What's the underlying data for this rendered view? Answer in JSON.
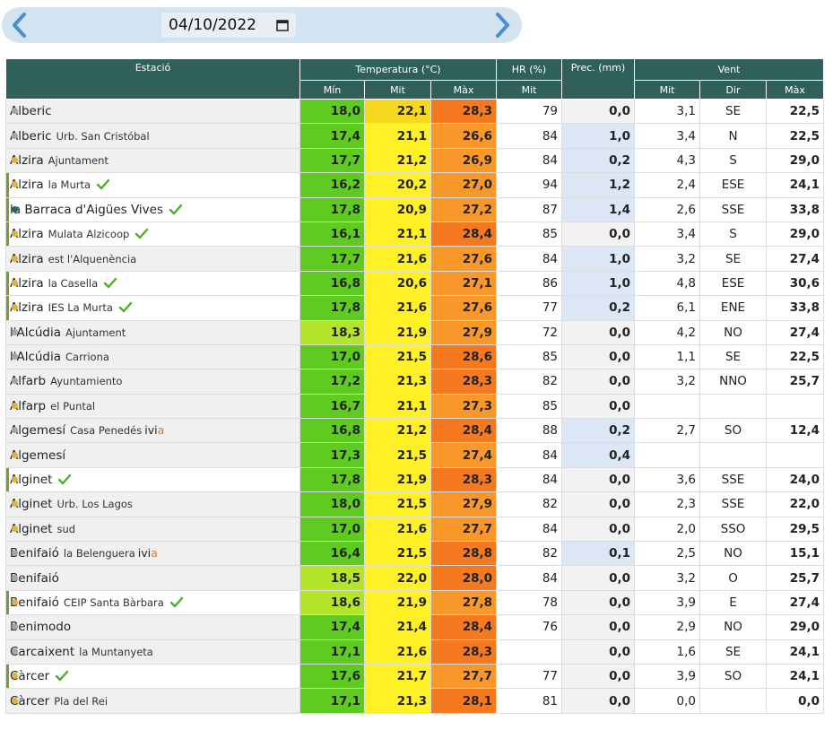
{
  "date": "04/10/2022",
  "headers": {
    "estacio": "Estació",
    "temperatura": "Temperatura (°C)",
    "hr": "HR (%)",
    "prec": "Prec. (mm)",
    "vent": "Vent",
    "min": "Mín",
    "mit": "Mit",
    "max": "Màx",
    "hr_mit": "Mit",
    "vent_mit": "Mit",
    "vent_dir": "Dir",
    "vent_max": "Màx"
  },
  "colors": {
    "header_bg": "#2f615a",
    "dot_grey": "#a5a5a5",
    "dot_gold": "#e2b23a",
    "dot_teal": "#1b6b5f",
    "check": "#4caf2a",
    "ivia_accent": "#d9782a"
  },
  "rows": [
    {
      "name": "Alberic",
      "sub": "",
      "ivia": false,
      "check": false,
      "dot": "grey",
      "hl": false,
      "min": "18,0",
      "mit": "22,1",
      "max": "28,3",
      "hr": "79",
      "prec": "0,0",
      "vmit": "3,1",
      "dir": "SE",
      "vmax": "22,5",
      "cmin": "#5fca1f",
      "cmit": "#f7d81e",
      "cmax": "#f57a1f"
    },
    {
      "name": "Alberic",
      "sub": "Urb. San Cristóbal",
      "ivia": false,
      "check": false,
      "dot": "grey",
      "hl": false,
      "min": "17,4",
      "mit": "21,1",
      "max": "26,6",
      "hr": "84",
      "prec": "1,0",
      "vmit": "3,4",
      "dir": "N",
      "vmax": "22,5",
      "cmin": "#5fca1f",
      "cmit": "#fff126",
      "cmax": "#f8972a"
    },
    {
      "name": "Alzira",
      "sub": "Ajuntament",
      "ivia": false,
      "check": false,
      "dot": "gold",
      "hl": false,
      "min": "17,7",
      "mit": "21,2",
      "max": "26,9",
      "hr": "84",
      "prec": "0,2",
      "vmit": "4,3",
      "dir": "S",
      "vmax": "29,0",
      "cmin": "#5fca1f",
      "cmit": "#fff126",
      "cmax": "#f8972a"
    },
    {
      "name": "Alzira",
      "sub": "la Murta",
      "ivia": false,
      "check": true,
      "dot": "gold",
      "hl": true,
      "min": "16,2",
      "mit": "20,2",
      "max": "27,0",
      "hr": "94",
      "prec": "1,2",
      "vmit": "2,4",
      "dir": "ESE",
      "vmax": "24,1",
      "cmin": "#5fca1f",
      "cmit": "#fff126",
      "cmax": "#f8972a"
    },
    {
      "name": "la Barraca d'Aigües Vives",
      "sub": "",
      "ivia": false,
      "check": true,
      "dot": "teal",
      "hl": true,
      "min": "17,8",
      "mit": "20,9",
      "max": "27,2",
      "hr": "87",
      "prec": "1,4",
      "vmit": "2,6",
      "dir": "SSE",
      "vmax": "33,8",
      "cmin": "#5fca1f",
      "cmit": "#fff126",
      "cmax": "#f8972a"
    },
    {
      "name": "Alzira",
      "sub": "Mulata Alzicoop",
      "ivia": false,
      "check": true,
      "dot": "gold",
      "hl": true,
      "min": "16,1",
      "mit": "21,1",
      "max": "28,4",
      "hr": "85",
      "prec": "0,0",
      "vmit": "3,4",
      "dir": "S",
      "vmax": "29,0",
      "cmin": "#5fca1f",
      "cmit": "#fff126",
      "cmax": "#f57a1f"
    },
    {
      "name": "Alzira",
      "sub": "est l'Alquenència",
      "ivia": false,
      "check": false,
      "dot": "gold",
      "hl": false,
      "min": "17,7",
      "mit": "21,6",
      "max": "27,6",
      "hr": "84",
      "prec": "1,0",
      "vmit": "3,2",
      "dir": "SE",
      "vmax": "27,4",
      "cmin": "#5fca1f",
      "cmit": "#fff126",
      "cmax": "#f8972a"
    },
    {
      "name": "Alzira",
      "sub": "la Casella",
      "ivia": false,
      "check": true,
      "dot": "gold",
      "hl": true,
      "min": "16,8",
      "mit": "20,6",
      "max": "27,1",
      "hr": "86",
      "prec": "1,0",
      "vmit": "4,8",
      "dir": "ESE",
      "vmax": "30,6",
      "cmin": "#5fca1f",
      "cmit": "#fff126",
      "cmax": "#f8972a"
    },
    {
      "name": "Alzira",
      "sub": "IES La Murta",
      "ivia": false,
      "check": true,
      "dot": "gold",
      "hl": true,
      "min": "17,8",
      "mit": "21,6",
      "max": "27,6",
      "hr": "77",
      "prec": "0,2",
      "vmit": "6,1",
      "dir": "ENE",
      "vmax": "33,8",
      "cmin": "#5fca1f",
      "cmit": "#fff126",
      "cmax": "#f8972a"
    },
    {
      "name": "l'Alcúdia",
      "sub": "Ajuntament",
      "ivia": false,
      "check": false,
      "dot": "grey",
      "hl": false,
      "min": "18,3",
      "mit": "21,9",
      "max": "27,9",
      "hr": "72",
      "prec": "0,0",
      "vmit": "4,2",
      "dir": "NO",
      "vmax": "27,4",
      "cmin": "#b5e52a",
      "cmit": "#fff126",
      "cmax": "#f8972a"
    },
    {
      "name": "l'Alcúdia",
      "sub": "Carriona",
      "ivia": false,
      "check": false,
      "dot": "grey",
      "hl": false,
      "min": "17,0",
      "mit": "21,5",
      "max": "28,6",
      "hr": "85",
      "prec": "0,0",
      "vmit": "1,1",
      "dir": "SE",
      "vmax": "22,5",
      "cmin": "#5fca1f",
      "cmit": "#fff126",
      "cmax": "#f57a1f"
    },
    {
      "name": "Alfarb",
      "sub": "Ayuntamiento",
      "ivia": false,
      "check": false,
      "dot": "grey",
      "hl": false,
      "min": "17,2",
      "mit": "21,3",
      "max": "28,3",
      "hr": "82",
      "prec": "0,0",
      "vmit": "3,2",
      "dir": "NNO",
      "vmax": "25,7",
      "cmin": "#5fca1f",
      "cmit": "#fff126",
      "cmax": "#f57a1f"
    },
    {
      "name": "Alfarp",
      "sub": "el Puntal",
      "ivia": false,
      "check": false,
      "dot": "gold",
      "hl": false,
      "min": "16,7",
      "mit": "21,1",
      "max": "27,3",
      "hr": "85",
      "prec": "0,0",
      "vmit": "",
      "dir": "",
      "vmax": "",
      "cmin": "#5fca1f",
      "cmit": "#fff126",
      "cmax": "#f8972a"
    },
    {
      "name": "Algemesí",
      "sub": "Casa Penedés",
      "ivia": true,
      "check": false,
      "dot": "grey",
      "hl": false,
      "min": "16,8",
      "mit": "21,2",
      "max": "28,4",
      "hr": "88",
      "prec": "0,2",
      "vmit": "2,7",
      "dir": "SO",
      "vmax": "12,4",
      "cmin": "#5fca1f",
      "cmit": "#fff126",
      "cmax": "#f57a1f"
    },
    {
      "name": "Algemesí",
      "sub": "",
      "ivia": false,
      "check": false,
      "dot": "gold",
      "hl": false,
      "min": "17,3",
      "mit": "21,5",
      "max": "27,4",
      "hr": "84",
      "prec": "0,4",
      "vmit": "",
      "dir": "",
      "vmax": "",
      "cmin": "#5fca1f",
      "cmit": "#fff126",
      "cmax": "#f8972a"
    },
    {
      "name": "Alginet",
      "sub": "",
      "ivia": false,
      "check": true,
      "dot": "gold",
      "hl": true,
      "min": "17,8",
      "mit": "21,9",
      "max": "28,3",
      "hr": "84",
      "prec": "0,0",
      "vmit": "3,6",
      "dir": "SSE",
      "vmax": "24,0",
      "cmin": "#5fca1f",
      "cmit": "#fff126",
      "cmax": "#f57a1f"
    },
    {
      "name": "Alginet",
      "sub": "Urb. Los Lagos",
      "ivia": false,
      "check": false,
      "dot": "gold",
      "hl": false,
      "min": "18,0",
      "mit": "21,5",
      "max": "27,9",
      "hr": "82",
      "prec": "0,0",
      "vmit": "2,3",
      "dir": "SSE",
      "vmax": "22,0",
      "cmin": "#5fca1f",
      "cmit": "#fff126",
      "cmax": "#f8972a"
    },
    {
      "name": "Alginet",
      "sub": "sud",
      "ivia": false,
      "check": false,
      "dot": "gold",
      "hl": false,
      "min": "17,0",
      "mit": "21,6",
      "max": "27,7",
      "hr": "84",
      "prec": "0,0",
      "vmit": "2,0",
      "dir": "SSO",
      "vmax": "29,5",
      "cmin": "#5fca1f",
      "cmit": "#fff126",
      "cmax": "#f8972a"
    },
    {
      "name": "Benifaió",
      "sub": "la Belenguera",
      "ivia": true,
      "check": false,
      "dot": "grey",
      "hl": false,
      "min": "16,4",
      "mit": "21,5",
      "max": "28,8",
      "hr": "82",
      "prec": "0,1",
      "vmit": "2,5",
      "dir": "NO",
      "vmax": "15,1",
      "cmin": "#5fca1f",
      "cmit": "#fff126",
      "cmax": "#f57a1f"
    },
    {
      "name": "Benifaió",
      "sub": "",
      "ivia": false,
      "check": false,
      "dot": "grey",
      "hl": false,
      "min": "18,5",
      "mit": "22,0",
      "max": "28,0",
      "hr": "84",
      "prec": "0,0",
      "vmit": "3,2",
      "dir": "O",
      "vmax": "25,7",
      "cmin": "#b5e52a",
      "cmit": "#fff126",
      "cmax": "#f57a1f"
    },
    {
      "name": "Benifaió",
      "sub": "CEIP Santa Bàrbara",
      "ivia": false,
      "check": true,
      "dot": "gold",
      "hl": true,
      "min": "18,6",
      "mit": "21,9",
      "max": "27,8",
      "hr": "78",
      "prec": "0,0",
      "vmit": "3,9",
      "dir": "E",
      "vmax": "27,4",
      "cmin": "#b5e52a",
      "cmit": "#fff126",
      "cmax": "#f8972a"
    },
    {
      "name": "Benimodo",
      "sub": "",
      "ivia": false,
      "check": false,
      "dot": "grey",
      "hl": false,
      "min": "17,4",
      "mit": "21,4",
      "max": "28,4",
      "hr": "76",
      "prec": "0,0",
      "vmit": "2,9",
      "dir": "NO",
      "vmax": "29,0",
      "cmin": "#5fca1f",
      "cmit": "#fff126",
      "cmax": "#f57a1f"
    },
    {
      "name": "Carcaixent",
      "sub": "la Muntanyeta",
      "ivia": false,
      "check": false,
      "dot": "grey",
      "hl": false,
      "min": "17,1",
      "mit": "21,6",
      "max": "28,3",
      "hr": "",
      "prec": "0,0",
      "vmit": "1,6",
      "dir": "SE",
      "vmax": "24,1",
      "cmin": "#5fca1f",
      "cmit": "#fff126",
      "cmax": "#f57a1f"
    },
    {
      "name": "Càrcer",
      "sub": "",
      "ivia": false,
      "check": true,
      "dot": "gold",
      "hl": true,
      "min": "17,6",
      "mit": "21,7",
      "max": "27,7",
      "hr": "77",
      "prec": "0,0",
      "vmit": "3,9",
      "dir": "SO",
      "vmax": "24,1",
      "cmin": "#5fca1f",
      "cmit": "#fff126",
      "cmax": "#f8972a"
    },
    {
      "name": "Càrcer",
      "sub": "Pla del Rei",
      "ivia": false,
      "check": false,
      "dot": "gold",
      "hl": false,
      "min": "17,1",
      "mit": "21,3",
      "max": "28,1",
      "hr": "81",
      "prec": "0,0",
      "vmit": "0,0",
      "dir": "",
      "vmax": "0,0",
      "cmin": "#5fca1f",
      "cmit": "#fff126",
      "cmax": "#f57a1f"
    }
  ]
}
